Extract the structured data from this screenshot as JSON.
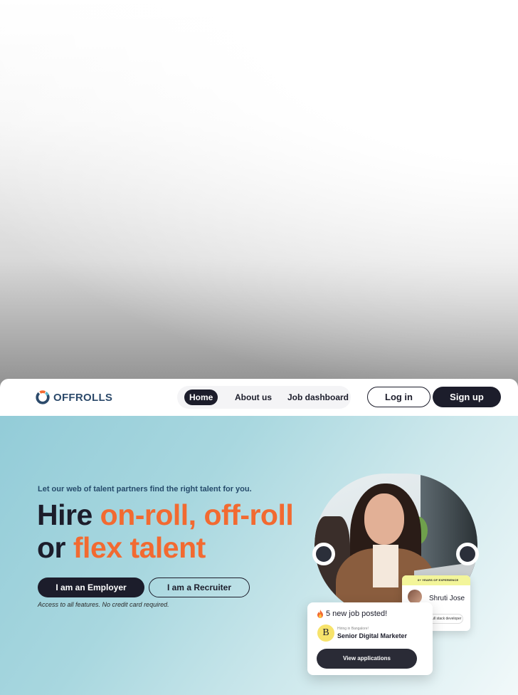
{
  "brand": {
    "name": "OFFROLLS"
  },
  "nav": {
    "items": [
      {
        "label": "Home",
        "active": true
      },
      {
        "label": "About us",
        "active": false
      },
      {
        "label": "Job dashboard",
        "active": false
      }
    ],
    "login_label": "Log in",
    "signup_label": "Sign up"
  },
  "hero": {
    "tagline": "Let our web of talent partners find the right talent for you.",
    "headline": {
      "part1": "Hire ",
      "part2": "on-roll, off-roll",
      "part3": " or ",
      "part4": "flex talent"
    },
    "employer_button": "I am an Employer",
    "recruiter_button": "I am a Recruiter",
    "note": "Access to all features. No credit card required."
  },
  "profile_card": {
    "experience": "6+ YEARS OF EXPERIENCE",
    "name": "Shruti Jose",
    "role": "Full stack developer"
  },
  "job_card": {
    "posted": "5 new job posted!",
    "company_initial": "B",
    "hiring_in": "Hiring in Bangalore!",
    "job_title": "Senior Digital Marketer",
    "view_button": "View applications"
  },
  "colors": {
    "dark": "#1c1d2b",
    "accent_orange": "#f26a31",
    "brand_blue": "#2c4a6b",
    "hero_start": "#93ccd8",
    "hero_end": "#f2f9fa",
    "badge_yellow": "#f3f59a"
  },
  "icons": {
    "logo": "offrolls-ring-logo",
    "fire": "fire-emoji-icon"
  }
}
